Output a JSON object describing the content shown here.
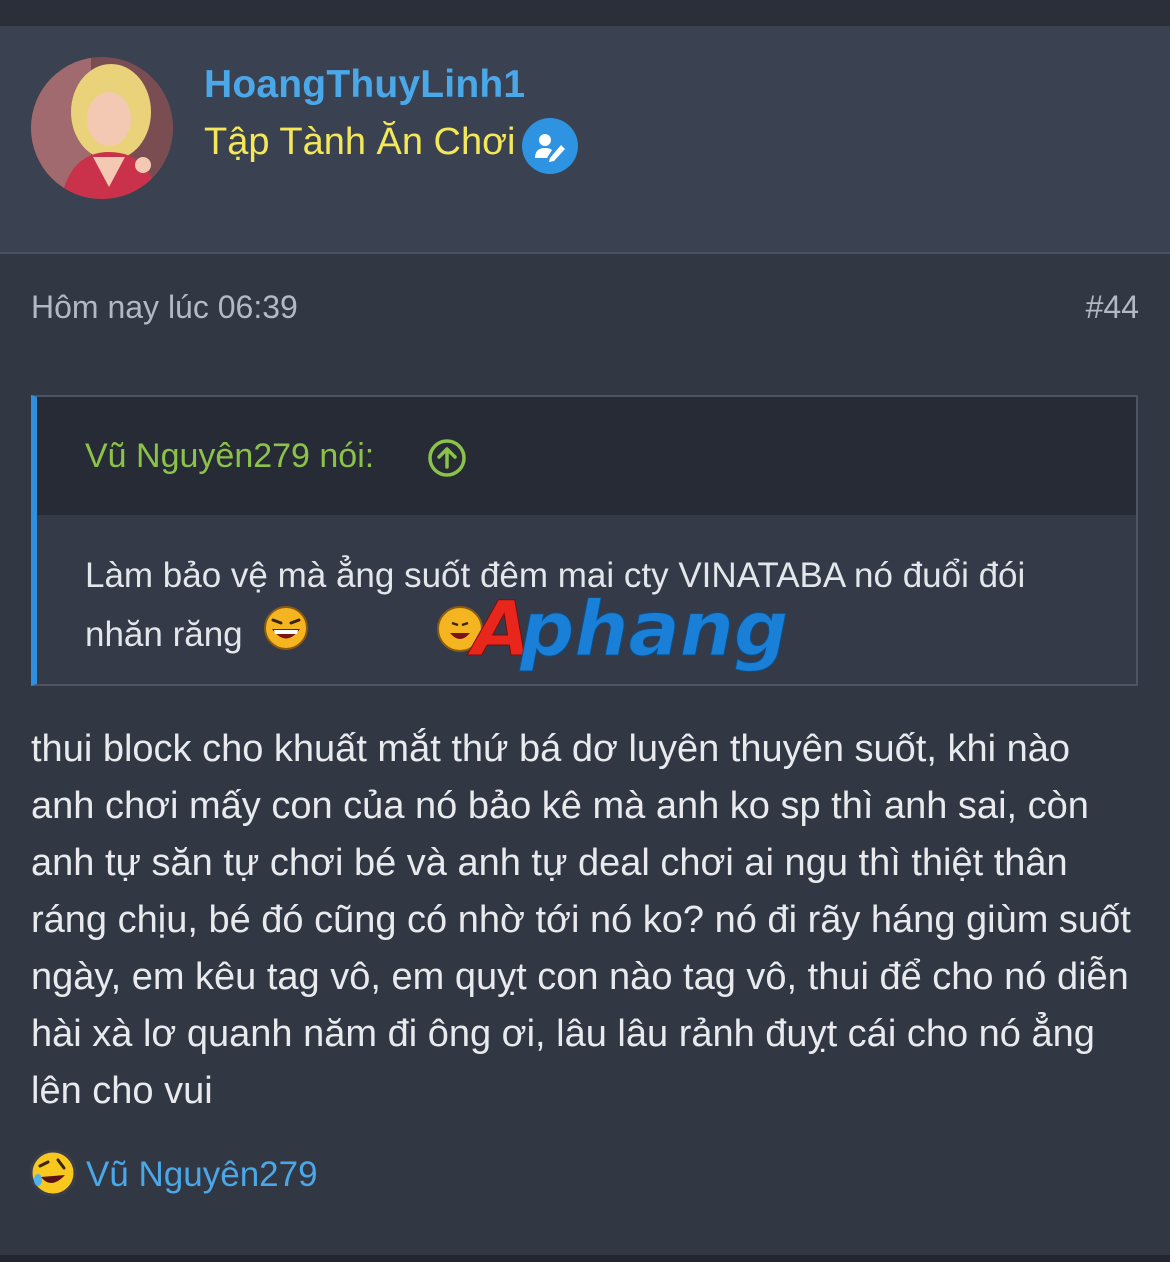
{
  "post": {
    "username": "HoangThuyLinh1",
    "user_title": "Tập Tành Ăn Chơi",
    "timestamp": "Hôm nay lúc 06:39",
    "post_number": "#44",
    "quote": {
      "author_line": "Vũ Nguyên279 nói:",
      "text": "Làm bảo vệ mà ẳng suốt đêm mai cty VINATABA nó đuổi đói nhăn răng"
    },
    "message": "thui block cho khuất mắt thứ bá dơ luyên thuyên suốt, khi nào anh chơi mấy con của nó bảo kê mà anh ko sp thì anh sai, còn anh tự săn tự chơi bé và anh tự deal chơi ai ngu thì thiệt thân ráng chịu, bé đó cũng có nhờ tới nó ko? nó đi rãy háng giùm suốt ngày, em kêu tag vô, em quỵt con nào tag vô, thui để cho nó diễn hài xà lơ quanh năm đi ông ơi, lâu lâu rảnh đuỵt cái cho nó ẳng lên cho vui",
    "reaction_user": "Vũ Nguyên279",
    "watermark": "Aphang"
  },
  "colors": {
    "username": "#4aa8e8",
    "user_title": "#f4e85a",
    "quote_author": "#8bc34a",
    "quote_accent": "#2f8fe0"
  },
  "icons": [
    "user-edit-badge-icon",
    "arrow-up-circle-icon",
    "laughing-emoji-icon",
    "rofl-emoji-icon"
  ]
}
